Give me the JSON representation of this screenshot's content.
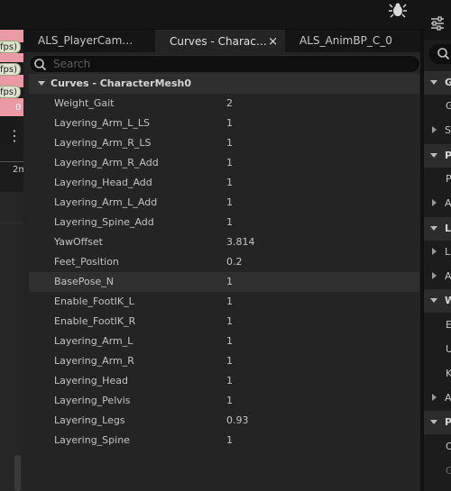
{
  "viewport": {
    "fps_badges": [
      "fps)",
      "fps)",
      "fps)"
    ],
    "zero_label": "0",
    "ruler_label": "2m"
  },
  "tabs": [
    {
      "label": "ALS_PlayerCam…",
      "active": false
    },
    {
      "label": "Curves - Charac…",
      "active": true,
      "close": "×"
    },
    {
      "label": "ALS_AnimBP_C_0",
      "active": false
    }
  ],
  "search": {
    "placeholder": "Search"
  },
  "section": {
    "title": "Curves - CharacterMesh0"
  },
  "curves": [
    {
      "name": "Weight_Gait",
      "value": "2"
    },
    {
      "name": "Layering_Arm_L_LS",
      "value": "1"
    },
    {
      "name": "Layering_Arm_R_LS",
      "value": "1"
    },
    {
      "name": "Layering_Arm_R_Add",
      "value": "1"
    },
    {
      "name": "Layering_Head_Add",
      "value": "1"
    },
    {
      "name": "Layering_Arm_L_Add",
      "value": "1"
    },
    {
      "name": "Layering_Spine_Add",
      "value": "1"
    },
    {
      "name": "YawOffset",
      "value": "3.814"
    },
    {
      "name": "Feet_Position",
      "value": "0.2"
    },
    {
      "name": "BasePose_N",
      "value": "1"
    },
    {
      "name": "Enable_FootIK_L",
      "value": "1"
    },
    {
      "name": "Enable_FootIK_R",
      "value": "1"
    },
    {
      "name": "Layering_Arm_L",
      "value": "1"
    },
    {
      "name": "Layering_Arm_R",
      "value": "1"
    },
    {
      "name": "Layering_Head",
      "value": "1"
    },
    {
      "name": "Layering_Pelvis",
      "value": "1"
    },
    {
      "name": "Layering_Legs",
      "value": "0.93"
    },
    {
      "name": "Layering_Spine",
      "value": "1"
    }
  ],
  "details": {
    "rows": [
      {
        "kind": "category",
        "letter": "G"
      },
      {
        "kind": "property",
        "letter": "G"
      },
      {
        "kind": "sub",
        "letter": "S"
      },
      {
        "kind": "category",
        "letter": "P"
      },
      {
        "kind": "property",
        "letter": "P"
      },
      {
        "kind": "sub",
        "letter": "A"
      },
      {
        "kind": "category",
        "letter": "L"
      },
      {
        "kind": "sub",
        "letter": "L"
      },
      {
        "kind": "sub",
        "letter": "A"
      },
      {
        "kind": "category",
        "letter": "W"
      },
      {
        "kind": "property",
        "letter": "E"
      },
      {
        "kind": "property",
        "letter": "U"
      },
      {
        "kind": "property",
        "letter": "K"
      },
      {
        "kind": "sub",
        "letter": "A"
      },
      {
        "kind": "category",
        "letter": "P"
      },
      {
        "kind": "property",
        "letter": "O"
      },
      {
        "kind": "property",
        "letter": "G"
      }
    ]
  },
  "colors": {
    "panel_bg": "#242424",
    "highlight_row": "#303030",
    "viewport_pink": "#e99aa5"
  }
}
